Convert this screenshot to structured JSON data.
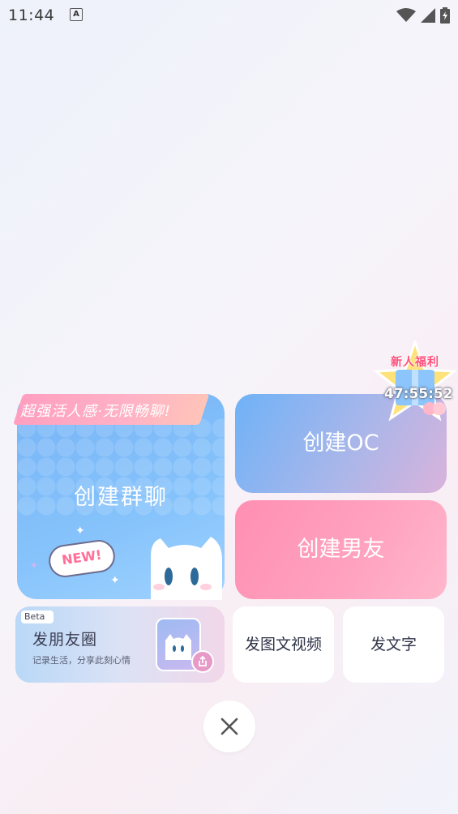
{
  "status_bar": {
    "time": "11:44",
    "notification_icon": "A"
  },
  "cards": {
    "group_chat": {
      "ribbon": "超强活人感·无限畅聊!",
      "title": "创建群聊",
      "badge": "NEW!"
    },
    "oc": {
      "title": "创建OC"
    },
    "boyfriend": {
      "title": "创建男友"
    },
    "moments": {
      "badge": "Beta",
      "title": "发朋友圈",
      "subtitle": "记录生活，分享此刻心情"
    },
    "image_video": {
      "title": "发图文视频"
    },
    "text": {
      "title": "发文字"
    }
  },
  "newbie_reward": {
    "title": "新人福利",
    "countdown": "47:55:52"
  },
  "colors": {
    "blue_accent": "#7ab6f6",
    "pink_accent": "#ff9bba",
    "text_dark": "#2f3348"
  }
}
